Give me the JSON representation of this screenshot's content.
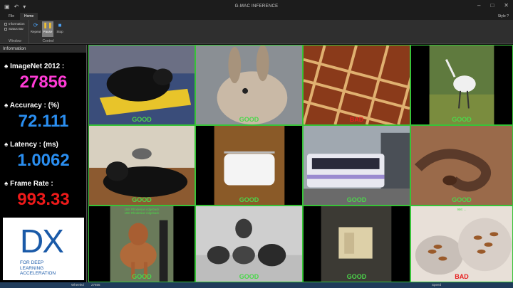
{
  "window": {
    "title": "G-MAC INFERENCE"
  },
  "ribbon": {
    "tabs": [
      "File",
      "Home"
    ],
    "style_label": "Style",
    "window_group": {
      "label": "Window",
      "checkboxes": [
        "Information",
        "Status Bar"
      ]
    },
    "control_group": {
      "label": "Control",
      "buttons": [
        "Repeat",
        "Pause",
        "Stop"
      ]
    }
  },
  "info": {
    "title": "Information",
    "metrics": [
      {
        "label": "ImageNet 2012 :",
        "value": "27856",
        "color": "#ff3bd6"
      },
      {
        "label": "Accuracy : (%)",
        "value": "72.111",
        "color": "#2a8ef0"
      },
      {
        "label": "Latency : (ms)",
        "value": "1.0062",
        "color": "#2a8ef0"
      },
      {
        "label": "Frame Rate :",
        "value": "993.33",
        "color": "#ee1a1a"
      }
    ],
    "logo": {
      "mark": "DX",
      "tagline": [
        "FOR DEEP",
        "LEARNING",
        "ACCELERATION"
      ]
    }
  },
  "grid": {
    "cells": [
      {
        "verdict": "GOOD",
        "scene": "guinea-pig"
      },
      {
        "verdict": "GOOD",
        "scene": "rabbit"
      },
      {
        "verdict": "BAD",
        "scene": "roof"
      },
      {
        "verdict": "GOOD",
        "scene": "spoonbill"
      },
      {
        "verdict": "GOOD",
        "scene": "dogs"
      },
      {
        "verdict": "GOOD",
        "scene": "paper-towel"
      },
      {
        "verdict": "GOOD",
        "scene": "streetcar"
      },
      {
        "verdict": "GOOD",
        "scene": "snake"
      },
      {
        "verdict": "GOOD",
        "scene": "ridgeback",
        "lines": [
          "159: Rhodesian ridgeback",
          "159: Rhodesian ridgeback"
        ]
      },
      {
        "verdict": "GOOD",
        "scene": "helmets"
      },
      {
        "verdict": "GOOD",
        "scene": "switch"
      },
      {
        "verdict": "BAD",
        "scene": "almonds",
        "lines": [
          "",
          "956: ..."
        ]
      }
    ]
  },
  "status": {
    "left_label": "Wheeled",
    "count": "27856",
    "right_label": "Speed"
  },
  "colors": {
    "good": "#4bd84b",
    "bad": "#e82020",
    "accent": "#2a8ef0"
  }
}
